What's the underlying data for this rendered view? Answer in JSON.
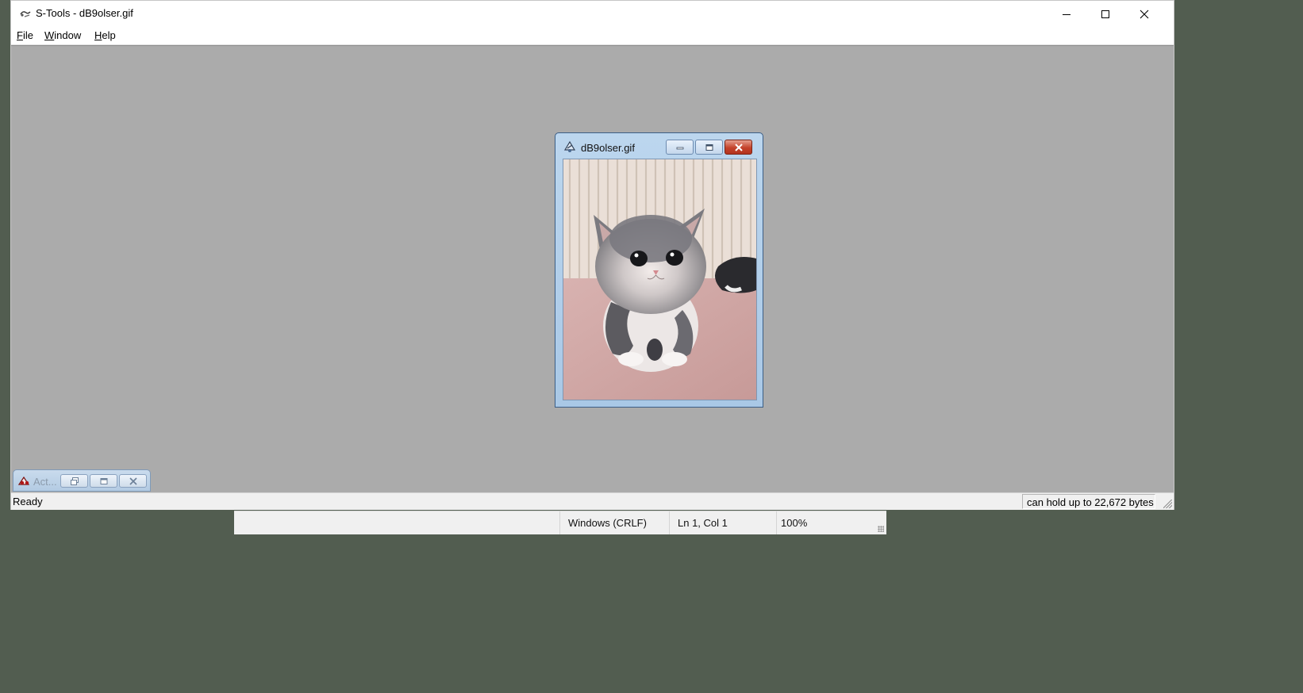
{
  "app": {
    "title": "S-Tools - dB9olser.gif",
    "icon": "stools-app-icon"
  },
  "window_controls": {
    "minimize": "minimize-icon",
    "maximize": "maximize-icon",
    "close": "close-icon"
  },
  "menu": {
    "items": [
      {
        "label": "File",
        "mnemonic": "F",
        "rest": "ile"
      },
      {
        "label": "Window",
        "mnemonic": "W",
        "rest": "indow"
      },
      {
        "label": "Help",
        "mnemonic": "H",
        "rest": "elp"
      }
    ]
  },
  "child_window": {
    "title": "dB9olser.gif",
    "icon": "stools-document-icon",
    "image": "grey-and-white kitten photo"
  },
  "minimized_window": {
    "title": "Act...",
    "icon": "stools-actions-icon"
  },
  "status": {
    "left": "Ready",
    "capacity": "can hold up to 22,672 bytes"
  },
  "background_status": {
    "line_ending": "Windows (CRLF)",
    "position": "Ln 1, Col 1",
    "zoom": "100%"
  },
  "colors": {
    "desktop": "#525d50",
    "mdi_background": "#ababab",
    "close_button": "#c4432b"
  }
}
